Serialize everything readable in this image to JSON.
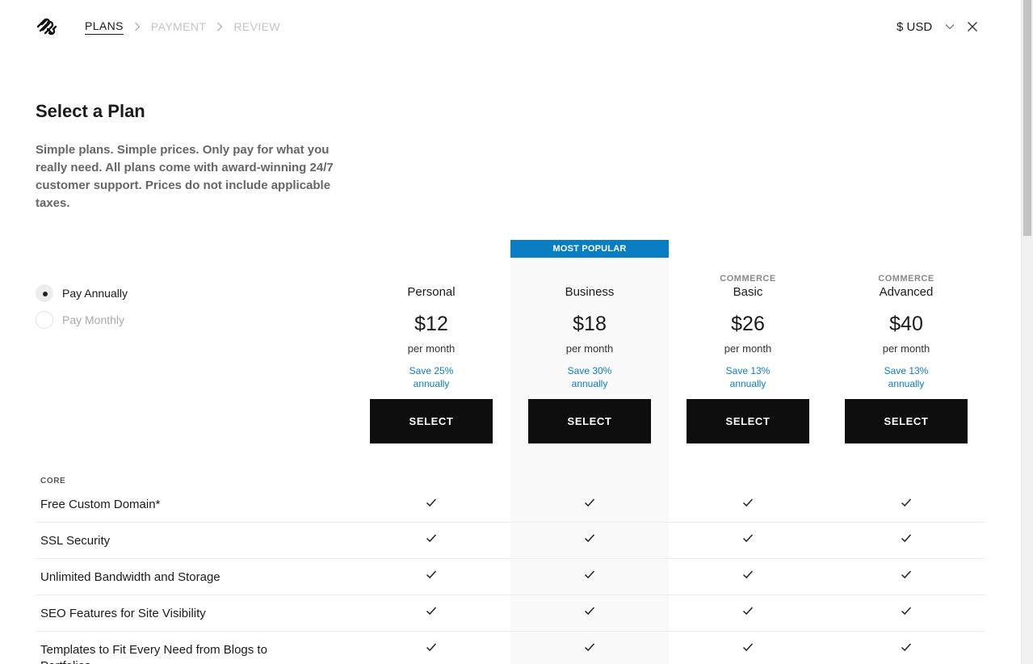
{
  "header": {
    "logo_icon": "squarespace-logo-icon",
    "breadcrumbs": [
      {
        "label": "PLANS",
        "active": true
      },
      {
        "label": "PAYMENT",
        "active": false
      },
      {
        "label": "REVIEW",
        "active": false
      }
    ],
    "currency": "$ USD"
  },
  "intro": {
    "title": "Select a Plan",
    "subtitle": "Simple plans. Simple prices. Only pay for what you really need. All plans come with award-winning 24/7 customer support. Prices do not include applicable taxes."
  },
  "billing": {
    "options": [
      {
        "label": "Pay Annually",
        "selected": true
      },
      {
        "label": "Pay Monthly",
        "selected": false
      }
    ]
  },
  "plans": [
    {
      "kicker": "",
      "name": "Personal",
      "price": "$12",
      "per": "per month",
      "save_line1": "Save 25%",
      "save_line2": "annually",
      "button": "SELECT"
    },
    {
      "kicker": "",
      "name": "Business",
      "price": "$18",
      "per": "per month",
      "save_line1": "Save 30%",
      "save_line2": "annually",
      "button": "SELECT",
      "badge": "MOST POPULAR"
    },
    {
      "kicker": "COMMERCE",
      "name": "Basic",
      "price": "$26",
      "per": "per month",
      "save_line1": "Save 13%",
      "save_line2": "annually",
      "button": "SELECT"
    },
    {
      "kicker": "COMMERCE",
      "name": "Advanced",
      "price": "$40",
      "per": "per month",
      "save_line1": "Save 13%",
      "save_line2": "annually",
      "button": "SELECT"
    }
  ],
  "features": {
    "section_label": "CORE",
    "rows": [
      {
        "name": "Free Custom Domain*",
        "checks": [
          true,
          true,
          true,
          true
        ]
      },
      {
        "name": "SSL Security",
        "checks": [
          true,
          true,
          true,
          true
        ]
      },
      {
        "name": "Unlimited Bandwidth and Storage",
        "checks": [
          true,
          true,
          true,
          true
        ]
      },
      {
        "name": "SEO Features for Site Visibility",
        "checks": [
          true,
          true,
          true,
          true
        ]
      },
      {
        "name": "Templates to Fit Every Need from Blogs to Portfolios",
        "checks": [
          true,
          true,
          true,
          true
        ]
      }
    ]
  },
  "colors": {
    "accent": "#0a7ec2",
    "button": "#0e0e0e",
    "popular_bg": "#f9f9f9"
  }
}
